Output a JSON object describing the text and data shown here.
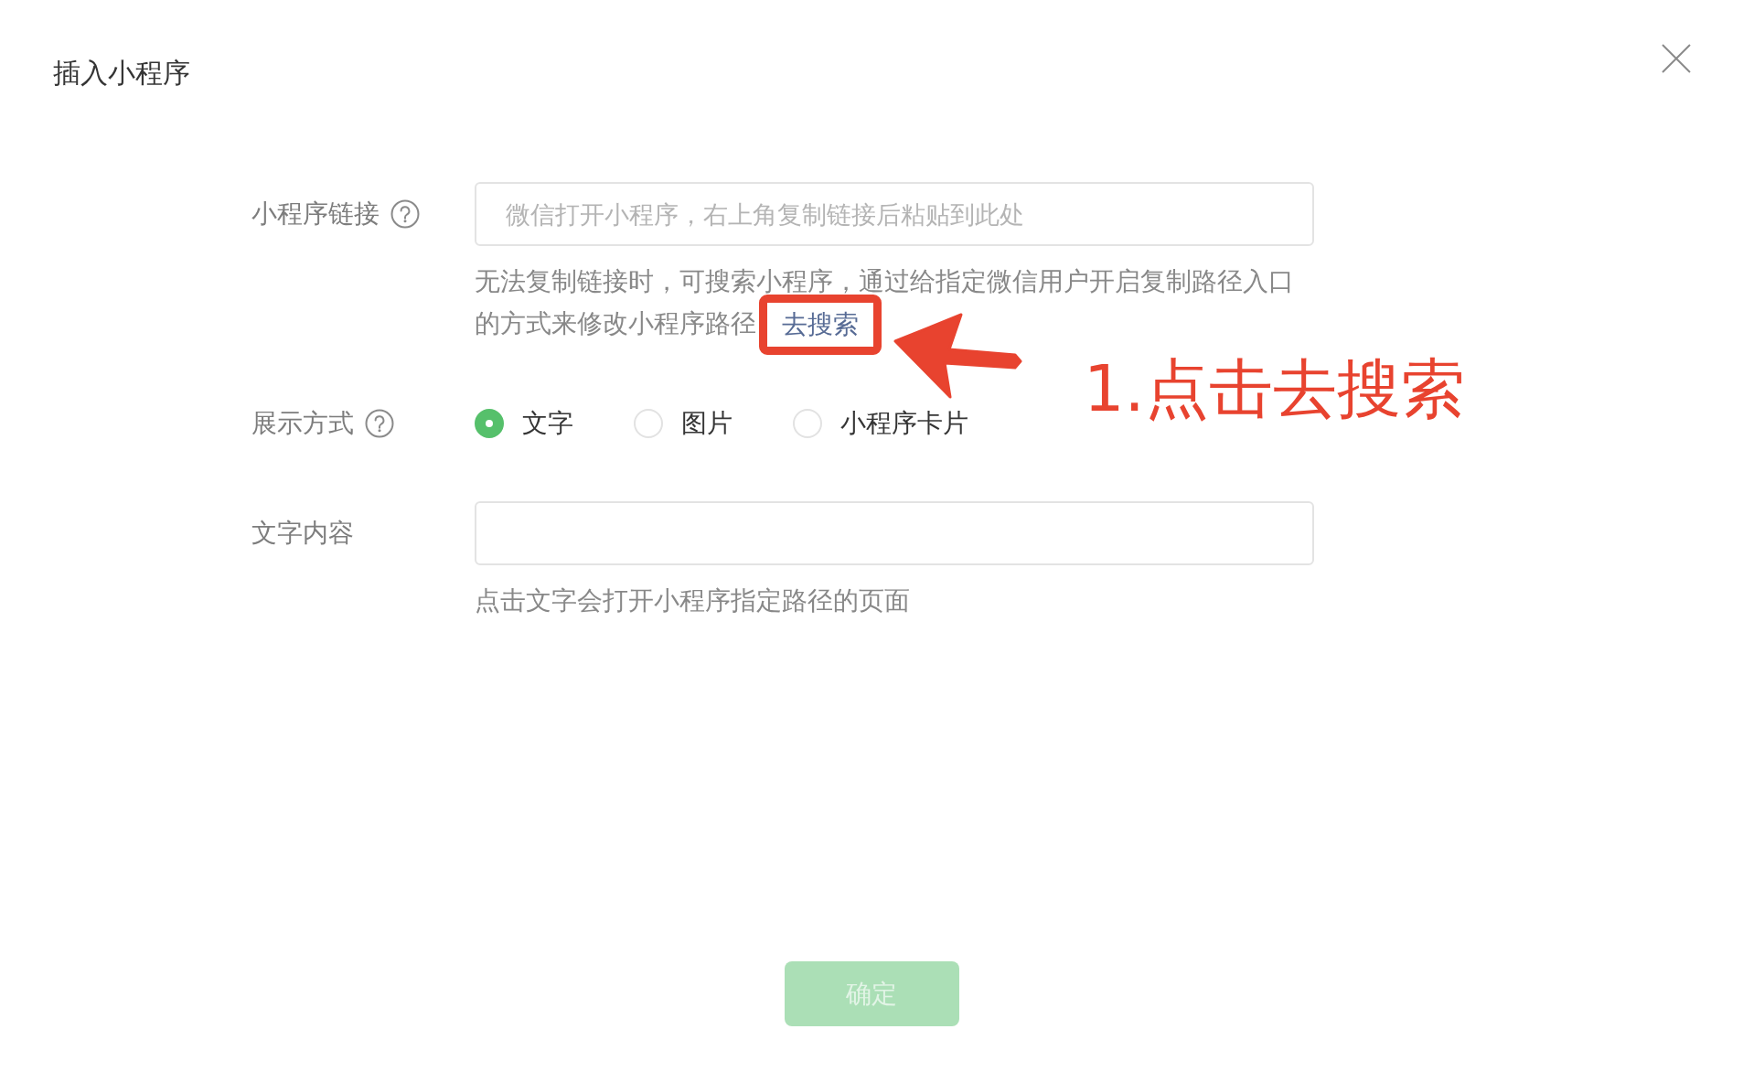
{
  "dialog": {
    "title": "插入小程序",
    "form": {
      "link": {
        "label": "小程序链接",
        "placeholder": "微信打开小程序，右上角复制链接后粘贴到此处",
        "help_text": "无法复制链接时，可搜索小程序，通过给指定微信用户开启复制路径入口的方式来修改小程序路径",
        "search_link": "去搜索"
      },
      "display_mode": {
        "label": "展示方式",
        "options": [
          {
            "label": "文字",
            "selected": true
          },
          {
            "label": "图片",
            "selected": false
          },
          {
            "label": "小程序卡片",
            "selected": false
          }
        ]
      },
      "text_content": {
        "label": "文字内容",
        "hint": "点击文字会打开小程序指定路径的页面"
      }
    },
    "confirm_button": {
      "label": "确定",
      "disabled": true
    }
  },
  "annotation": {
    "text": "1.点击去搜索"
  }
}
